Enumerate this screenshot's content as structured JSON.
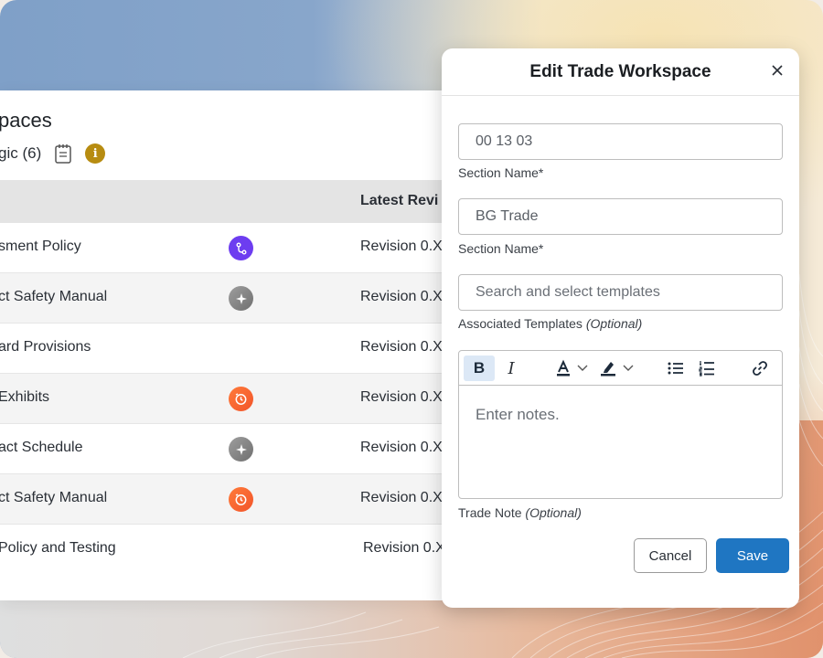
{
  "page": {
    "title": "paces",
    "subtitle": "gic (6)"
  },
  "table": {
    "header_revision": "Latest Revi",
    "rows": [
      {
        "name": "sment Policy",
        "badge": "workflow-icon",
        "revision": "Revision 0.X"
      },
      {
        "name": "ct Safety Manual",
        "badge": "sparkle-icon",
        "revision": "Revision 0.X"
      },
      {
        "name": "ard Provisions",
        "badge": "",
        "revision": "Revision 0.X"
      },
      {
        "name": "Exhibits",
        "badge": "history-icon",
        "revision": "Revision 0.X"
      },
      {
        "name": "act Schedule",
        "badge": "sparkle-icon",
        "revision": "Revision 0.X"
      },
      {
        "name": "ct Safety Manual",
        "badge": "history-icon",
        "revision": "Revision 0.X"
      },
      {
        "name": "Policy and Testing",
        "badge": "",
        "revision": "Revision 0.X"
      }
    ]
  },
  "modal": {
    "title": "Edit Trade Workspace",
    "section_number_value": "00 13 03",
    "section_number_label": "Section Name*",
    "section_name_value": "BG Trade",
    "section_name_label": "Section Name*",
    "templates_placeholder": "Search and select templates",
    "templates_label": "Associated Templates",
    "templates_optional": "(Optional)",
    "toolbar": {
      "bold": "B",
      "italic": "I"
    },
    "notes_placeholder": "Enter notes.",
    "notes_label": "Trade Note",
    "notes_optional": "(Optional)",
    "cancel_label": "Cancel",
    "save_label": "Save"
  },
  "colors": {
    "primary": "#1f76c2",
    "badge_purple": "#6d3df0",
    "badge_gray": "#8a8a8a",
    "badge_orange": "#f2542a",
    "info": "#b78c11"
  }
}
